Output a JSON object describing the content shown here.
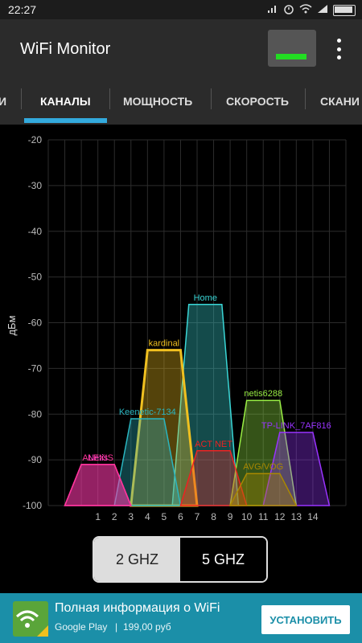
{
  "status_bar": {
    "time": "22:27"
  },
  "app": {
    "title": "WiFi Monitor"
  },
  "tabs": [
    {
      "label": "И"
    },
    {
      "label": "КАНАЛЫ"
    },
    {
      "label": "МОЩНОСТЬ"
    },
    {
      "label": "СКОРОСТЬ"
    },
    {
      "label": "СКАНИ"
    }
  ],
  "band_toggle": {
    "left": "2 GHZ",
    "right": "5 GHZ",
    "selected": "2 GHZ"
  },
  "ad": {
    "title": "Полная информация о WiFi",
    "store": "Google Play",
    "separator": "|",
    "price": "199,00 руб",
    "button": "УСТАНОВИТЬ"
  },
  "colors": {
    "accent": "#33aadd",
    "meter": "#22dd22",
    "ad_bg": "#1b8fa8"
  },
  "icons": [
    "wifi-signal-icon",
    "alarm-icon",
    "wifi-icon",
    "cell-signal-icon",
    "battery-icon",
    "menu-dots-icon",
    "wifi-app-icon"
  ],
  "chart_data": {
    "type": "area",
    "ylabel": "дБм",
    "xlabel": "",
    "yticks": [
      -20,
      -30,
      -40,
      -50,
      -60,
      -70,
      -80,
      -90,
      -100
    ],
    "ylim": [
      -100,
      -20
    ],
    "xticks": [
      1,
      2,
      3,
      4,
      5,
      6,
      7,
      8,
      9,
      10,
      11,
      12,
      13,
      14
    ],
    "xlim": [
      -2,
      16
    ],
    "grid": true,
    "series": [
      {
        "name": "Home",
        "channel": 7.5,
        "value": -56,
        "color": "#3ad6d6"
      },
      {
        "name": "kardinal",
        "channel": 5,
        "value": -66,
        "color": "#f0c020"
      },
      {
        "name": "Keenetic-7134",
        "channel": 4,
        "value": -81,
        "color": "#2ab5c0"
      },
      {
        "name": "netis6288",
        "channel": 11,
        "value": -77,
        "color": "#99ee44"
      },
      {
        "name": "TP-LINK_7AF816",
        "channel": 13,
        "value": -84,
        "color": "#9933ff"
      },
      {
        "name": "ACT NET",
        "channel": 8,
        "value": -88,
        "color": "#ee2222"
      },
      {
        "name": "AVG/VOG",
        "channel": 11,
        "value": -93,
        "color": "#aa8800"
      },
      {
        "name": "Netis",
        "channel": 1,
        "value": -91,
        "color": "#ff44cc"
      },
      {
        "name": "ALEXIS",
        "channel": 1,
        "value": -91,
        "color": "#ff3399"
      }
    ]
  }
}
